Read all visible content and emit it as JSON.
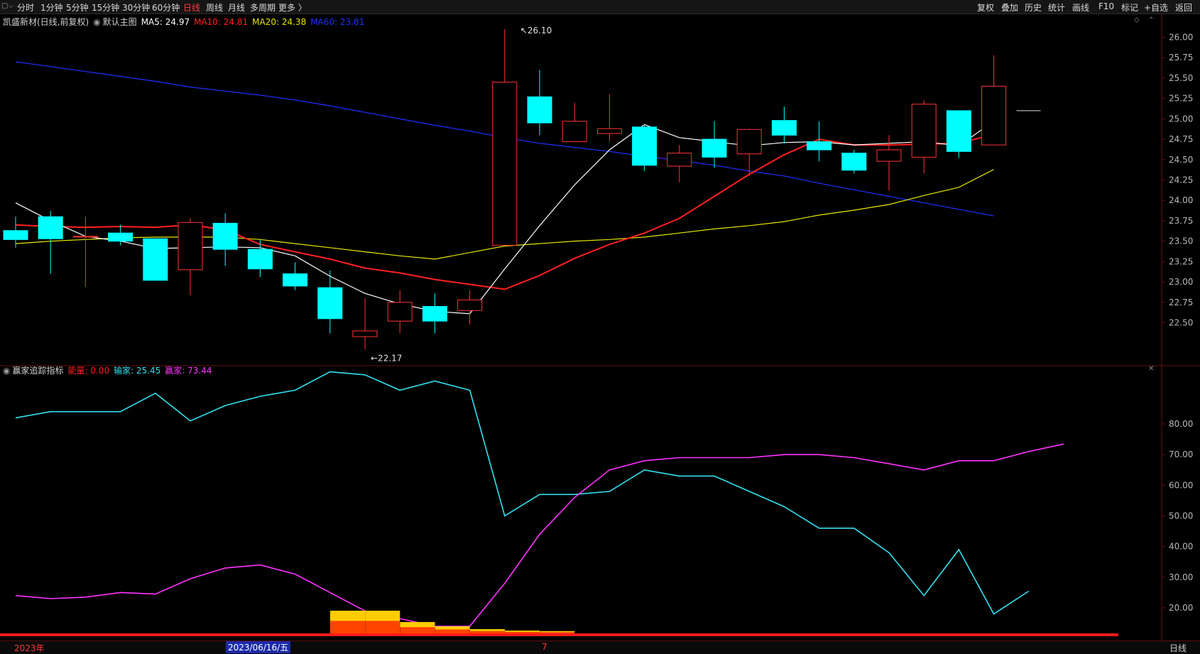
{
  "toolbar": {
    "periods": [
      "分时",
      "1分钟",
      "5分钟",
      "15分钟",
      "30分钟",
      "60分钟",
      "日线",
      "周线",
      "月线",
      "多周期",
      "更多 〉"
    ],
    "active_period": "日线",
    "right_buttons": [
      "复权",
      "叠加",
      "历史",
      "统计",
      "画线",
      "F10",
      "标记",
      "+自选",
      "返回"
    ]
  },
  "main_info": {
    "title": "凯盛新材(日线,前复权)",
    "chart_mode": "默认主图",
    "ma5": "MA5: 24.97",
    "ma10": "MA10: 24.81",
    "ma20": "MA20: 24.38",
    "ma60": "MA60: 23.81"
  },
  "indicator_info": {
    "name": "赢家追踪指标",
    "energy": "能量: 0.00",
    "loser": "输家: 25.45",
    "winner": "赢家: 73.44"
  },
  "bottom_bar": {
    "year_label": "2023年",
    "cursor_date": "2023/06/16/五",
    "month_label": "7",
    "period_label": "日线"
  },
  "annotations": {
    "high": "26.10",
    "low": "22.17"
  },
  "colors": {
    "up": "#ff3333",
    "down": "#00ffff",
    "ma5": "#ffffff",
    "ma10": "#ff2020",
    "ma20": "#e6e600",
    "ma60": "#2030ff",
    "loser": "#33e0f0",
    "winner": "#ff33ff"
  },
  "chart_data": [
    {
      "type": "candlestick",
      "ylim": [
        22.2,
        26.1
      ],
      "yticks": [
        "26.00",
        "25.75",
        "25.50",
        "25.25",
        "25.00",
        "24.75",
        "24.50",
        "24.25",
        "24.00",
        "23.75",
        "23.50",
        "23.25",
        "23.00",
        "22.75",
        "22.50"
      ],
      "candles": [
        {
          "o": 23.63,
          "h": 23.8,
          "l": 23.42,
          "c": 23.52
        },
        {
          "o": 23.8,
          "h": 23.87,
          "l": 23.1,
          "c": 23.53
        },
        {
          "o": 23.55,
          "h": 23.8,
          "l": 22.94,
          "c": 23.56
        },
        {
          "o": 23.6,
          "h": 23.7,
          "l": 23.45,
          "c": 23.5
        },
        {
          "o": 23.53,
          "h": 23.53,
          "l": 23.02,
          "c": 23.02
        },
        {
          "o": 23.15,
          "h": 23.78,
          "l": 22.84,
          "c": 23.73
        },
        {
          "o": 23.72,
          "h": 23.84,
          "l": 23.2,
          "c": 23.4
        },
        {
          "o": 23.4,
          "h": 23.52,
          "l": 23.06,
          "c": 23.16
        },
        {
          "o": 23.1,
          "h": 23.24,
          "l": 22.9,
          "c": 22.95
        },
        {
          "o": 22.93,
          "h": 23.14,
          "l": 22.37,
          "c": 22.55
        },
        {
          "o": 22.33,
          "h": 22.8,
          "l": 22.17,
          "c": 22.4
        },
        {
          "o": 22.52,
          "h": 22.9,
          "l": 22.37,
          "c": 22.75
        },
        {
          "o": 22.7,
          "h": 22.86,
          "l": 22.37,
          "c": 22.52
        },
        {
          "o": 22.65,
          "h": 22.9,
          "l": 22.48,
          "c": 22.78
        },
        {
          "o": 23.45,
          "h": 26.1,
          "l": 23.45,
          "c": 25.45
        },
        {
          "o": 25.27,
          "h": 25.6,
          "l": 24.8,
          "c": 24.95
        },
        {
          "o": 24.72,
          "h": 25.2,
          "l": 24.72,
          "c": 24.97
        },
        {
          "o": 24.82,
          "h": 25.3,
          "l": 24.72,
          "c": 24.88
        },
        {
          "o": 24.9,
          "h": 24.93,
          "l": 24.36,
          "c": 24.43
        },
        {
          "o": 24.42,
          "h": 24.68,
          "l": 24.22,
          "c": 24.58
        },
        {
          "o": 24.75,
          "h": 24.97,
          "l": 24.4,
          "c": 24.53
        },
        {
          "o": 24.57,
          "h": 24.88,
          "l": 24.3,
          "c": 24.87
        },
        {
          "o": 24.98,
          "h": 25.15,
          "l": 24.7,
          "c": 24.8
        },
        {
          "o": 24.72,
          "h": 24.97,
          "l": 24.48,
          "c": 24.62
        },
        {
          "o": 24.58,
          "h": 24.62,
          "l": 24.33,
          "c": 24.37
        },
        {
          "o": 24.48,
          "h": 24.8,
          "l": 24.12,
          "c": 24.62
        },
        {
          "o": 24.53,
          "h": 25.23,
          "l": 24.33,
          "c": 25.18
        },
        {
          "o": 25.1,
          "h": 25.1,
          "l": 24.52,
          "c": 24.6
        },
        {
          "o": 24.68,
          "h": 25.78,
          "l": 24.68,
          "c": 25.4
        }
      ],
      "ma5": [
        23.97,
        23.75,
        23.56,
        23.5,
        23.41,
        23.42,
        23.43,
        23.42,
        23.32,
        23.07,
        22.86,
        22.73,
        22.64,
        22.61,
        23.16,
        23.69,
        24.19,
        24.62,
        24.93,
        24.77,
        24.72,
        24.67,
        24.71,
        24.72,
        24.68,
        24.7,
        24.72,
        24.67,
        24.97
      ],
      "ma10": [
        23.7,
        23.68,
        23.67,
        23.68,
        23.67,
        23.7,
        23.64,
        23.46,
        23.37,
        23.28,
        23.17,
        23.11,
        23.03,
        22.97,
        22.91,
        23.08,
        23.29,
        23.46,
        23.6,
        23.78,
        24.05,
        24.32,
        24.56,
        24.75,
        24.68,
        24.68,
        24.69,
        24.7,
        24.81
      ],
      "ma20": [
        23.47,
        23.5,
        23.52,
        23.54,
        23.55,
        23.55,
        23.55,
        23.52,
        23.47,
        23.42,
        23.37,
        23.32,
        23.28,
        23.36,
        23.44,
        23.47,
        23.5,
        23.52,
        23.55,
        23.6,
        23.65,
        23.69,
        23.74,
        23.82,
        23.88,
        23.95,
        24.06,
        24.16,
        24.38
      ],
      "ma60": [
        25.7,
        25.64,
        25.58,
        25.52,
        25.46,
        25.39,
        25.34,
        25.29,
        25.23,
        25.16,
        25.08,
        25.0,
        24.92,
        24.85,
        24.77,
        24.7,
        24.65,
        24.6,
        24.54,
        24.49,
        24.43,
        24.36,
        24.3,
        24.21,
        24.13,
        24.05,
        23.97,
        23.89,
        23.81
      ],
      "right_tick_value": 25.1
    },
    {
      "type": "line",
      "name": "赢家追踪指标",
      "yticks": [
        "80.00",
        "70.00",
        "60.00",
        "50.00",
        "40.00",
        "30.00",
        "20.00"
      ],
      "ylim": [
        0,
        98
      ],
      "series": [
        {
          "name": "输家",
          "values": [
            82,
            84,
            84,
            84,
            90,
            81,
            86,
            89,
            91,
            97,
            96,
            91,
            94,
            91,
            50,
            57,
            57,
            58,
            65,
            63,
            63,
            58,
            53,
            46,
            46,
            38,
            24,
            39,
            18,
            25.45
          ]
        },
        {
          "name": "赢家",
          "values": [
            24,
            23,
            23.5,
            25,
            24.5,
            29.5,
            33,
            34,
            31,
            25,
            19,
            16.5,
            14,
            14,
            28,
            44,
            56,
            65,
            68,
            69,
            69,
            69,
            70,
            70,
            69,
            67,
            65,
            68,
            68,
            71,
            73.44
          ]
        }
      ],
      "energy_bars": [
        {
          "i": 9,
          "v": 8
        },
        {
          "i": 10,
          "v": 8
        },
        {
          "i": 11,
          "v": 4
        },
        {
          "i": 12,
          "v": 2.5
        },
        {
          "i": 13,
          "v": 1.5
        },
        {
          "i": 14,
          "v": 1
        },
        {
          "i": 15,
          "v": 0.8
        }
      ]
    }
  ]
}
